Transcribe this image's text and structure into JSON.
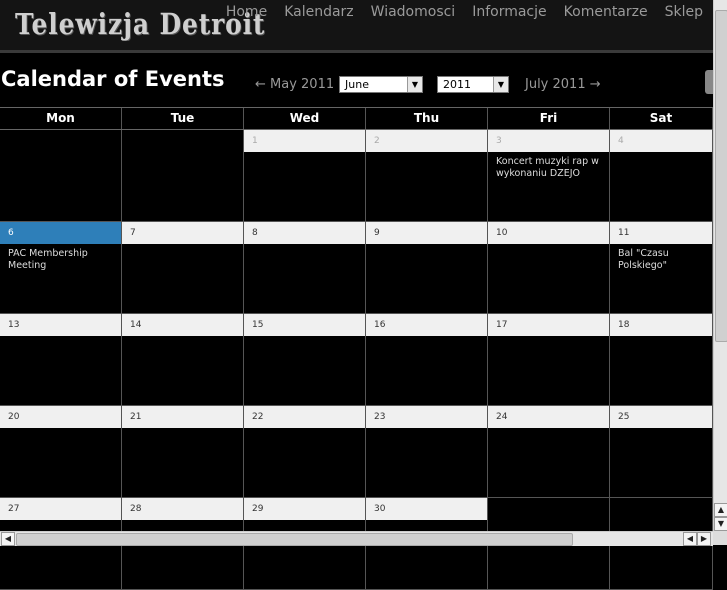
{
  "site": {
    "logo": "Telewizja Detroit",
    "nav": [
      "Home",
      "Kalendarz",
      "Wiadomosci",
      "Informacje",
      "Komentarze",
      "Sklep"
    ]
  },
  "calendar": {
    "title": "Calendar of Events",
    "prev_label": "← May 2011",
    "next_label": "July 2011 →",
    "month_select": "June",
    "year_select": "2011",
    "days_of_week": [
      "Mon",
      "Tue",
      "Wed",
      "Thu",
      "Fri",
      "Sat"
    ],
    "weeks": [
      [
        {
          "day": "",
          "state": "blank",
          "event": ""
        },
        {
          "day": "",
          "state": "blank",
          "event": ""
        },
        {
          "day": "1",
          "state": "other",
          "event": ""
        },
        {
          "day": "2",
          "state": "other",
          "event": ""
        },
        {
          "day": "3",
          "state": "other",
          "event": "Koncert muzyki rap w wykonaniu DZEJO"
        },
        {
          "day": "4",
          "state": "other",
          "event": ""
        }
      ],
      [
        {
          "day": "6",
          "state": "today",
          "event": "PAC Membership Meeting"
        },
        {
          "day": "7",
          "state": "normal",
          "event": ""
        },
        {
          "day": "8",
          "state": "normal",
          "event": ""
        },
        {
          "day": "9",
          "state": "normal",
          "event": ""
        },
        {
          "day": "10",
          "state": "normal",
          "event": ""
        },
        {
          "day": "11",
          "state": "normal",
          "event": "Bal \"Czasu Polskiego\""
        }
      ],
      [
        {
          "day": "13",
          "state": "normal",
          "event": ""
        },
        {
          "day": "14",
          "state": "normal",
          "event": ""
        },
        {
          "day": "15",
          "state": "normal",
          "event": ""
        },
        {
          "day": "16",
          "state": "normal",
          "event": ""
        },
        {
          "day": "17",
          "state": "normal",
          "event": ""
        },
        {
          "day": "18",
          "state": "normal",
          "event": ""
        }
      ],
      [
        {
          "day": "20",
          "state": "normal",
          "event": ""
        },
        {
          "day": "21",
          "state": "normal",
          "event": ""
        },
        {
          "day": "22",
          "state": "normal",
          "event": ""
        },
        {
          "day": "23",
          "state": "normal",
          "event": ""
        },
        {
          "day": "24",
          "state": "normal",
          "event": ""
        },
        {
          "day": "25",
          "state": "normal",
          "event": ""
        }
      ],
      [
        {
          "day": "27",
          "state": "normal",
          "event": ""
        },
        {
          "day": "28",
          "state": "normal",
          "event": ""
        },
        {
          "day": "29",
          "state": "normal",
          "event": ""
        },
        {
          "day": "30",
          "state": "normal",
          "event": ""
        },
        {
          "day": "",
          "state": "blank",
          "event": ""
        },
        {
          "day": "",
          "state": "blank",
          "event": ""
        }
      ]
    ]
  },
  "colors": {
    "today": "#2e7fb9",
    "background": "#000000",
    "day_header": "#f0f0f0"
  },
  "icons": {
    "scroll_up": "triangle-up-icon",
    "scroll_down": "triangle-down-icon",
    "scroll_left": "triangle-left-icon",
    "scroll_right": "triangle-right-icon",
    "select_arrow": "chevron-down-icon"
  }
}
